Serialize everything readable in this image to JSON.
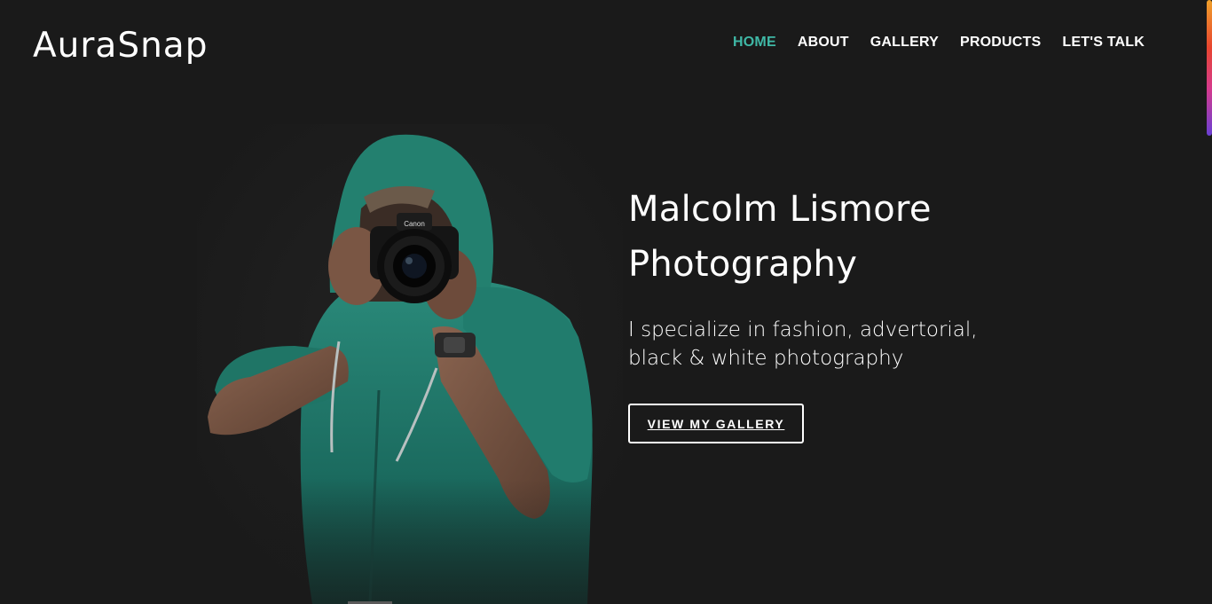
{
  "brand": {
    "logo_text": "AuraSnap"
  },
  "nav": {
    "items": [
      {
        "label": "HOME",
        "active": true
      },
      {
        "label": "ABOUT",
        "active": false
      },
      {
        "label": "GALLERY",
        "active": false
      },
      {
        "label": "PRODUCTS",
        "active": false
      },
      {
        "label": "LET'S TALK",
        "active": false
      }
    ]
  },
  "hero": {
    "title_line1": "Malcolm Lismore",
    "title_line2": "Photography",
    "subtitle_line1": "I specialize in fashion, advertorial,",
    "subtitle_line2": "black & white photography",
    "cta_label": "VIEW MY GALLERY",
    "photo_subject": "photographer in green hoodie holding camera",
    "camera_brand": "Canon"
  },
  "colors": {
    "background": "#1a1a1a",
    "accent": "#3fb8a6",
    "text": "#ffffff",
    "hoodie": "#1f7a6c"
  }
}
